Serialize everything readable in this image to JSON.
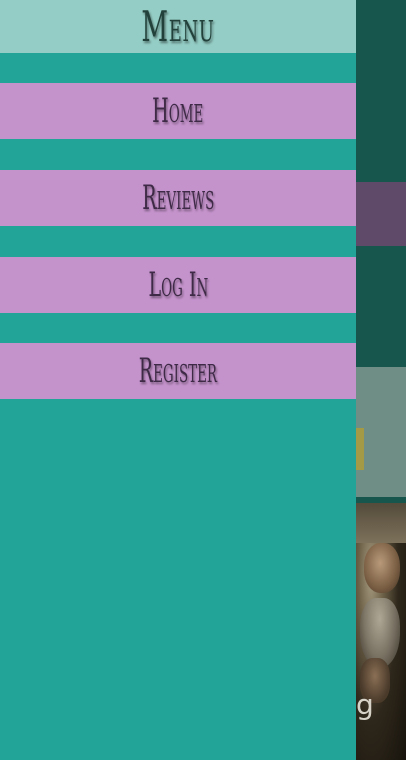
{
  "drawer": {
    "title": "Menu",
    "items": [
      {
        "label": "Home"
      },
      {
        "label": "Reviews"
      },
      {
        "label": "Log In"
      },
      {
        "label": "Register"
      }
    ]
  },
  "background": {
    "poster_glyph": "g"
  },
  "colors": {
    "drawer_bg": "#22a598",
    "header_bg": "#94cdc5",
    "item_bg": "#c593cc",
    "page_bg": "#16564d"
  }
}
